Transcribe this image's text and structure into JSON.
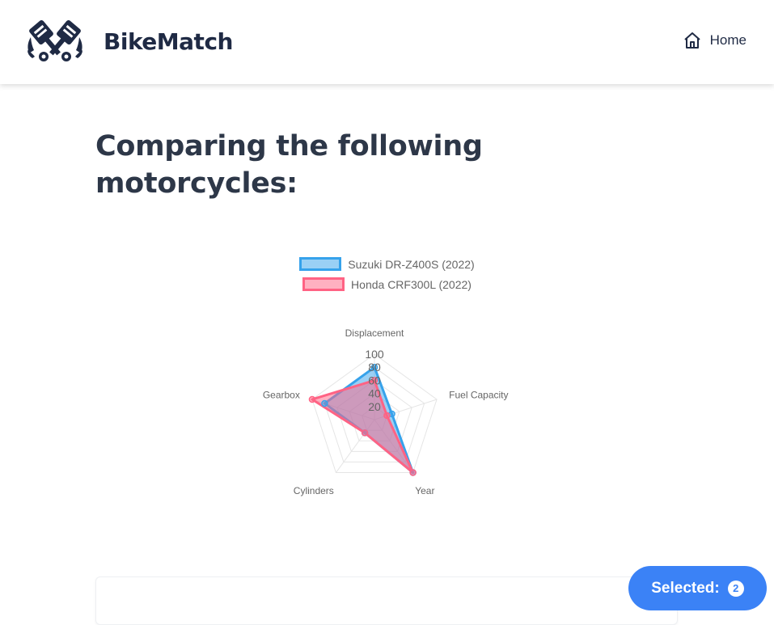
{
  "nav": {
    "brand": "BikeMatch",
    "home_label": "Home"
  },
  "page": {
    "title": "Comparing the following motorcycles:"
  },
  "chart_data": {
    "type": "radar",
    "labels": [
      "Displacement",
      "Fuel Capacity",
      "Year",
      "Cylinders",
      "Gearbox"
    ],
    "scale": {
      "min": 0,
      "max": 100,
      "ticks": [
        20,
        40,
        60,
        80,
        100
      ]
    },
    "series": [
      {
        "name": "Suzuki DR-Z400S (2022)",
        "values": [
          80,
          28,
          100,
          25,
          80
        ],
        "border": "#36a2eb",
        "fill": "rgba(54,162,235,0.5)"
      },
      {
        "name": "Honda CRF300L (2022)",
        "values": [
          60,
          20,
          100,
          25,
          100
        ],
        "border": "#ff6384",
        "fill": "rgba(255,99,132,0.5)"
      }
    ]
  },
  "selected": {
    "label": "Selected:",
    "count": "2"
  },
  "colors": {
    "brand_navy": "#1f2a44",
    "title_text": "#2d3748",
    "selected_button": "#3b82f6"
  }
}
